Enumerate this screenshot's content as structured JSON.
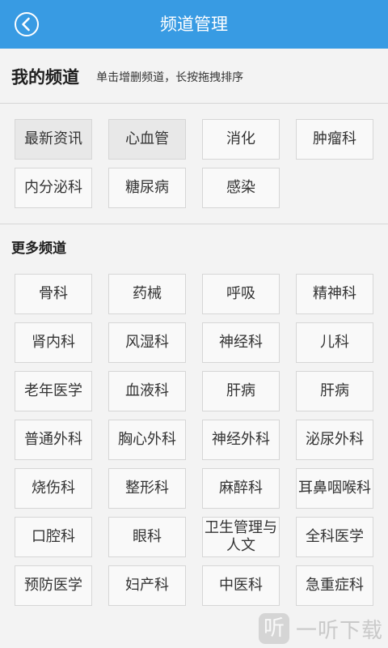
{
  "header": {
    "title": "频道管理",
    "back_icon": "back-chevron-icon"
  },
  "my_channels": {
    "title": "我的频道",
    "hint": "单击增删频道，长按拖拽排序",
    "items": [
      {
        "label": "最新资讯",
        "highlighted": true
      },
      {
        "label": "心血管",
        "highlighted": true
      },
      {
        "label": "消化",
        "highlighted": false
      },
      {
        "label": "肿瘤科",
        "highlighted": false
      },
      {
        "label": "内分泌科",
        "highlighted": false
      },
      {
        "label": "糖尿病",
        "highlighted": false
      },
      {
        "label": "感染",
        "highlighted": false
      }
    ]
  },
  "more_channels": {
    "title": "更多频道",
    "items": [
      {
        "label": "骨科"
      },
      {
        "label": "药械"
      },
      {
        "label": "呼吸"
      },
      {
        "label": "精神科"
      },
      {
        "label": "肾内科"
      },
      {
        "label": "风湿科"
      },
      {
        "label": "神经科"
      },
      {
        "label": "儿科"
      },
      {
        "label": "老年医学"
      },
      {
        "label": "血液科"
      },
      {
        "label": "肝病"
      },
      {
        "label": "肝病"
      },
      {
        "label": "普通外科"
      },
      {
        "label": "胸心外科"
      },
      {
        "label": "神经外科"
      },
      {
        "label": "泌尿外科"
      },
      {
        "label": "烧伤科"
      },
      {
        "label": "整形科"
      },
      {
        "label": "麻醉科"
      },
      {
        "label": "耳鼻咽喉科"
      },
      {
        "label": "口腔科"
      },
      {
        "label": "眼科"
      },
      {
        "label": "卫生管理与人文"
      },
      {
        "label": "全科医学"
      },
      {
        "label": "预防医学"
      },
      {
        "label": "妇产科"
      },
      {
        "label": "中医科"
      },
      {
        "label": "急重症科"
      }
    ]
  },
  "watermark": {
    "logo_glyph": "听",
    "text": "一听下载"
  },
  "colors": {
    "header_bg": "#389be3",
    "page_bg": "#f3f3f3",
    "tile_bg": "#f9f9f9",
    "tile_highlight_bg": "#e8e8e8",
    "tile_border": "#d6d6d6"
  }
}
